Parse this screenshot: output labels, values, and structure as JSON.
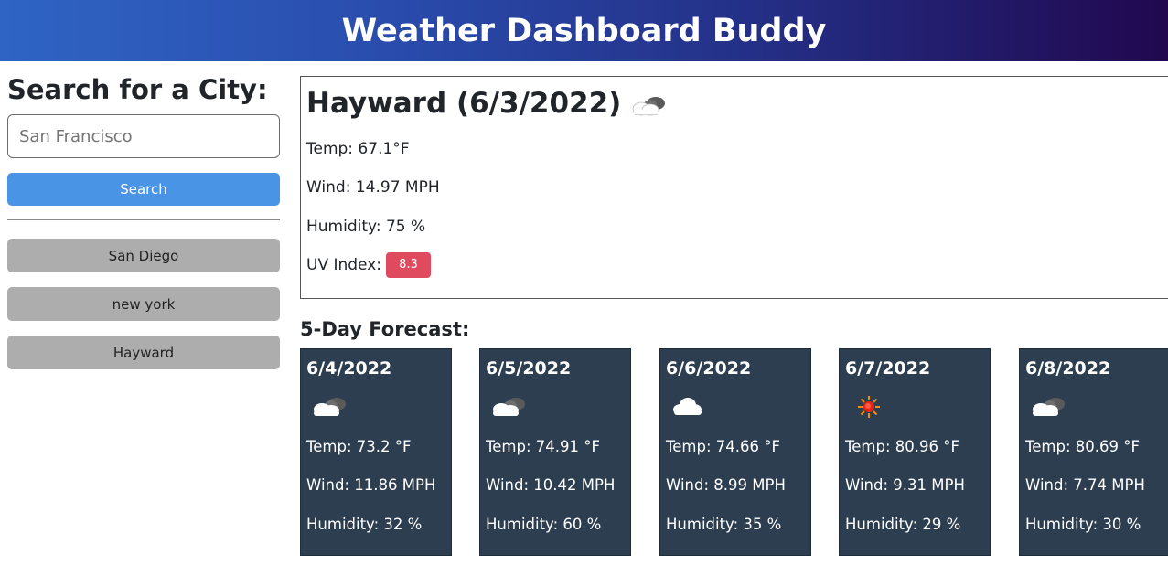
{
  "header": {
    "title": "Weather Dashboard Buddy"
  },
  "search": {
    "heading": "Search for a City:",
    "value": "",
    "placeholder": "San Francisco",
    "button_label": "Search"
  },
  "history": [
    {
      "label": "San Diego"
    },
    {
      "label": "new york"
    },
    {
      "label": "Hayward"
    }
  ],
  "current": {
    "title": "Hayward (6/3/2022)",
    "icon": "broken-clouds-icon",
    "temp": "Temp: 67.1°F",
    "wind": "Wind: 14.97 MPH",
    "humidity": "Humidity: 75 %",
    "uv_label": "UV Index:",
    "uv_value": "8.3"
  },
  "forecast": {
    "heading": "5-Day Forecast:",
    "days": [
      {
        "date": "6/4/2022",
        "icon": "broken-clouds-icon",
        "temp": "Temp: 73.2 °F",
        "wind": "Wind: 11.86 MPH",
        "humidity": "Humidity: 32 %"
      },
      {
        "date": "6/5/2022",
        "icon": "broken-clouds-icon",
        "temp": "Temp: 74.91 °F",
        "wind": "Wind: 10.42 MPH",
        "humidity": "Humidity: 60 %"
      },
      {
        "date": "6/6/2022",
        "icon": "cloud-icon",
        "temp": "Temp: 74.66 °F",
        "wind": "Wind: 8.99 MPH",
        "humidity": "Humidity: 35 %"
      },
      {
        "date": "6/7/2022",
        "icon": "sun-icon",
        "temp": "Temp: 80.96 °F",
        "wind": "Wind: 9.31 MPH",
        "humidity": "Humidity: 29 %"
      },
      {
        "date": "6/8/2022",
        "icon": "broken-clouds-icon",
        "temp": "Temp: 80.69 °F",
        "wind": "Wind: 7.74 MPH",
        "humidity": "Humidity: 30 %"
      }
    ]
  },
  "colors": {
    "header_gradient_start": "#2f64c4",
    "header_gradient_end": "#21084f",
    "search_button": "#4a94e6",
    "history_button": "#adadad",
    "uv_badge": "#e04a5f",
    "forecast_card": "#2c3e50"
  }
}
